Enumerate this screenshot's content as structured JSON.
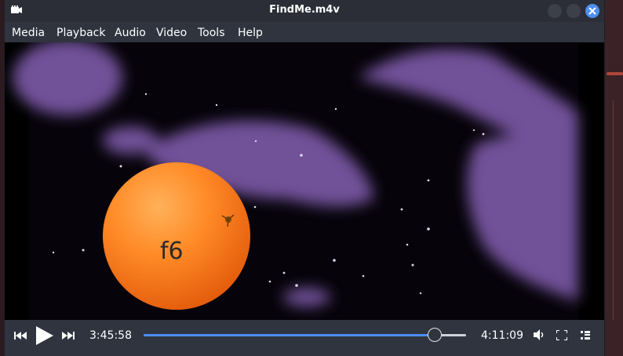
{
  "window": {
    "title": "FindMe.m4v"
  },
  "menu": [
    "Media",
    "Playback",
    "Audio",
    "Video",
    "Tools",
    "Help"
  ],
  "video": {
    "overlay_text": "f6"
  },
  "controls": {
    "elapsed": "3:45:58",
    "total": "4:11:09",
    "progress_fraction": 0.903
  },
  "colors": {
    "accent": "#4d8ef0",
    "window_bg": "#2f343f",
    "titlebar_bg": "#2b2e37"
  },
  "icons": [
    "camera-icon",
    "minimize-icon",
    "maximize-icon",
    "close-icon",
    "previous-icon",
    "play-icon",
    "next-icon",
    "volume-icon",
    "fullscreen-icon",
    "playlist-icon"
  ]
}
